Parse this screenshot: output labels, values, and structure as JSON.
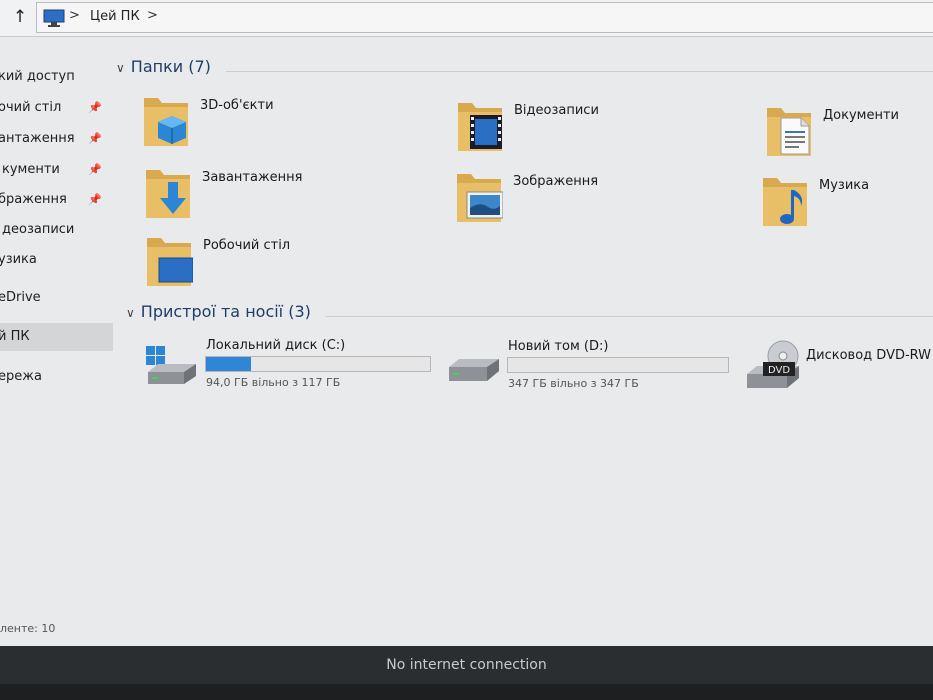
{
  "address_bar": {
    "current": "Цей ПК"
  },
  "sidebar": {
    "items": [
      {
        "label": "кий доступ",
        "pinned": false
      },
      {
        "label": "очий стіл",
        "pinned": true
      },
      {
        "label": "антаження",
        "pinned": true
      },
      {
        "label": "кументи",
        "pinned": true
      },
      {
        "label": "браження",
        "pinned": true
      },
      {
        "label": "деозаписи",
        "pinned": false
      },
      {
        "label": "узика",
        "pinned": false
      },
      {
        "label": "eDrive",
        "pinned": false
      },
      {
        "label": "й ПК",
        "pinned": false,
        "selected": true
      },
      {
        "label": "ережа",
        "pinned": false
      }
    ]
  },
  "folders_section": {
    "title": "Папки (7)",
    "folders": [
      {
        "name": "3D-об'єкти",
        "icon": "3d-objects-folder-icon"
      },
      {
        "name": "Відеозаписи",
        "icon": "videos-folder-icon"
      },
      {
        "name": "Документи",
        "icon": "documents-folder-icon"
      },
      {
        "name": "Завантаження",
        "icon": "downloads-folder-icon"
      },
      {
        "name": "Зображення",
        "icon": "pictures-folder-icon"
      },
      {
        "name": "Музика",
        "icon": "music-folder-icon"
      },
      {
        "name": "Робочий стіл",
        "icon": "desktop-folder-icon"
      }
    ]
  },
  "devices_section": {
    "title": "Пристрої та носії (3)",
    "drives": [
      {
        "name": "Локальний диск (C:)",
        "free_text": "94,0 ГБ вільно з 117 ГБ",
        "used_fraction": 0.2
      },
      {
        "name": "Новий том (D:)",
        "free_text": "347 ГБ вільно з 347 ГБ",
        "used_fraction": 0.0
      },
      {
        "name": "Дисковод DVD-RW (",
        "dvd_label": "DVD"
      }
    ]
  },
  "status_bar": {
    "items_count": "ленте: 10"
  },
  "notification": {
    "text": "No internet connection"
  },
  "colors": {
    "accent": "#2f86d6",
    "section_header": "#1f3d6a",
    "folder": "#d9a94f"
  }
}
